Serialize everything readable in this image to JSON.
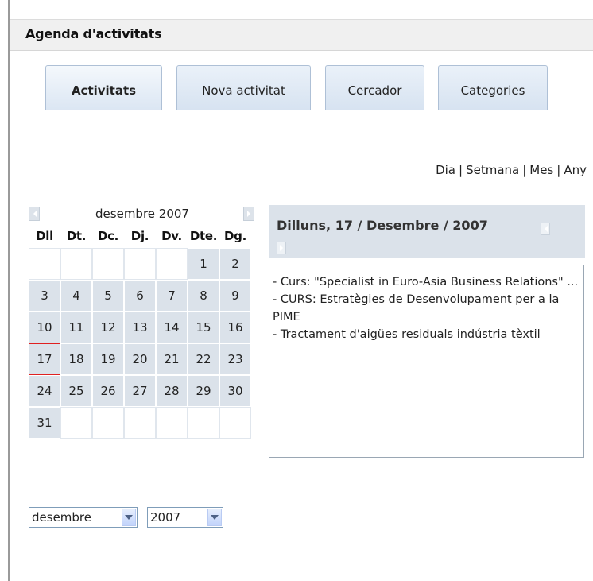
{
  "header": {
    "title": "Agenda d'activitats"
  },
  "tabs": [
    {
      "label": "Activitats",
      "active": true
    },
    {
      "label": "Nova activitat",
      "active": false
    },
    {
      "label": "Cercador",
      "active": false
    },
    {
      "label": "Categories",
      "active": false
    }
  ],
  "view_links": [
    "Dia",
    "Setmana",
    "Mes",
    "Any"
  ],
  "calendar": {
    "month_label": "desembre 2007",
    "weekdays": [
      "Dll",
      "Dt.",
      "Dc.",
      "Dj.",
      "Dv.",
      "Dte.",
      "Dg."
    ],
    "weeks": [
      [
        "",
        "",
        "",
        "",
        "",
        "1",
        "2"
      ],
      [
        "3",
        "4",
        "5",
        "6",
        "7",
        "8",
        "9"
      ],
      [
        "10",
        "11",
        "12",
        "13",
        "14",
        "15",
        "16"
      ],
      [
        "17",
        "18",
        "19",
        "20",
        "21",
        "22",
        "23"
      ],
      [
        "24",
        "25",
        "26",
        "27",
        "28",
        "29",
        "30"
      ],
      [
        "31",
        "",
        "",
        "",
        "",
        "",
        ""
      ]
    ],
    "selected_day": "17",
    "month_select": "desembre",
    "year_select": "2007"
  },
  "day_panel": {
    "title": "Dilluns, 17 / Desembre / 2007",
    "events": [
      "- Curs: \"Specialist in Euro-Asia Business Relations\" ...",
      "- CURS: Estratègies de Desenvolupament per a la PIME",
      "- Tractament d'aigües residuals indústria tèxtil"
    ]
  }
}
